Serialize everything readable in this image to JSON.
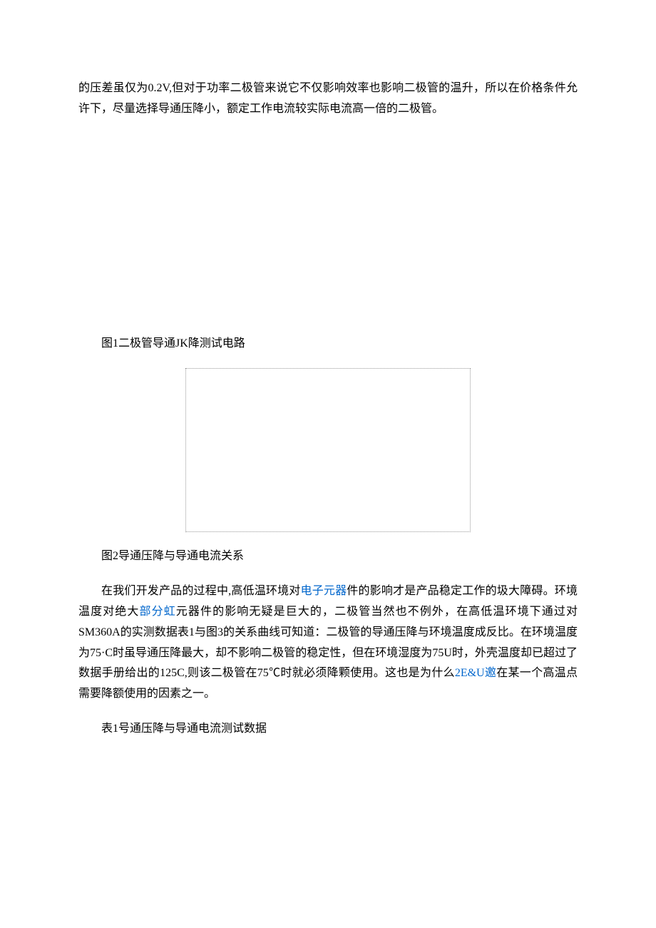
{
  "intro_paragraph": {
    "part1": "的压差虽仅为0.2V,但对于功率二极管来说它不仅影响效率也影响二极管的温升，所以在价格条件允许下，尽量选择导通压降小，额定工作电流较实际电流高一倍的二极管。"
  },
  "figure1": {
    "caption": "图1二极管导通JK降测试电路"
  },
  "figure2": {
    "caption": "图2导通压降与导通电流关系"
  },
  "body": {
    "part1": "在我们开发产品的过程中,高低温环境对",
    "link1": "电子元器",
    "part2": "件的影响才是产品稳定工作的圾大障碍。环境温度对绝大",
    "link2": "部分虹",
    "part3": "元器件的影响无疑是巨大的，二极管当然也不例外，在高低温环境下通过对SM360A的实测数据表1与图3的关系曲线可知道：二极管的导通压降与环境温度成反比。在环境温度为75·C时虽导通压降最大，却不影响二极管的稳定性，但在环境湿度为75U时，外壳温度却已超过了数据手册给出的125C,则该二极管在75℃时就必须降颗使用。这也是为什么",
    "link3": "2E&U邀",
    "part4": "在某一个高温点需要降额使用的因素之一。"
  },
  "table1": {
    "caption": "表1号通压降与导通电流测试数据"
  }
}
